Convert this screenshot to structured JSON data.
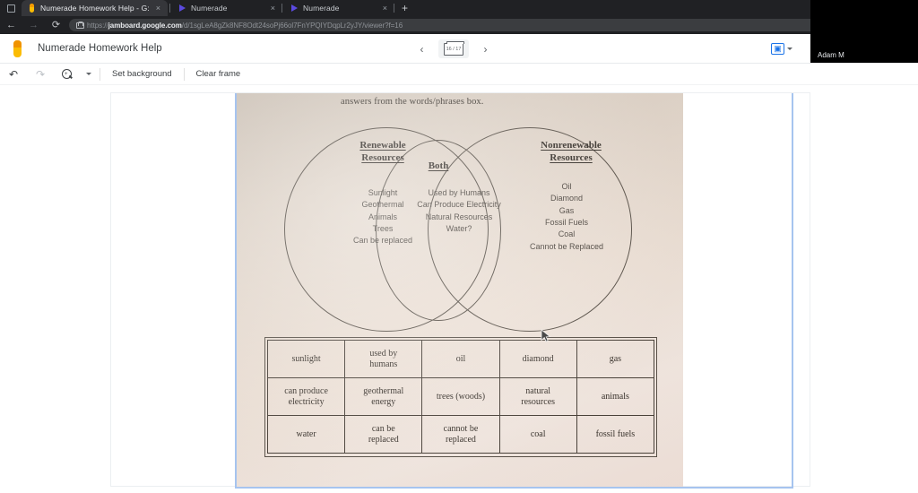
{
  "browser": {
    "window_icon": "window-restore-icon",
    "tabs": [
      {
        "title": "Numerade Homework Help - G:",
        "favicon": "jamboard-icon",
        "active": true,
        "close": "×"
      },
      {
        "title": "Numerade",
        "favicon": "numerade-icon",
        "active": false,
        "close": "×"
      },
      {
        "title": "Numerade",
        "favicon": "numerade-icon",
        "active": false,
        "close": "×"
      }
    ],
    "new_tab_label": "+",
    "back_label": "←",
    "forward_label": "→",
    "reload_label": "⟳",
    "url_scheme": "https://",
    "url_host": "jamboard.google.com",
    "url_path": "/d/1sgLeA8gZk8NF8Odt24soPj66ol7FnYPQIYDqpLr2yJY/viewer?f=16",
    "omnibox_icons": [
      "font-size-icon",
      "extensions-icon"
    ]
  },
  "jamboard": {
    "logo": "jamboard-logo-icon",
    "title": "Numerade Homework Help",
    "frame_nav": {
      "prev": "‹",
      "next": "›",
      "frame_counter": "16 / 17",
      "thumbnail_icon": "frame-thumbnail-icon"
    },
    "present_button_label": "▣",
    "present_caret": "▾",
    "toolbar": {
      "undo": "↶",
      "redo": "↷",
      "zoom_icon": "zoom-in-icon",
      "zoom_caret": "▾",
      "set_background": "Set background",
      "clear_frame": "Clear frame"
    },
    "tools": [
      {
        "name": "pen-tool",
        "glyph": "✎",
        "active": false
      },
      {
        "name": "eraser-tool",
        "glyph": "◢",
        "active": false
      },
      {
        "name": "select-tool",
        "glyph": "➤",
        "active": true
      },
      {
        "name": "sticky-note-tool",
        "glyph": "▤",
        "active": false
      },
      {
        "name": "image-tool",
        "glyph": "◰",
        "active": false
      },
      {
        "name": "shape-tool",
        "glyph": "○",
        "active": false
      },
      {
        "name": "text-box-tool",
        "glyph": "⊞",
        "active": false
      },
      {
        "name": "laser-tool",
        "glyph": "⚡",
        "active": false
      }
    ]
  },
  "video": {
    "participant_name": "Adam M"
  },
  "worksheet": {
    "instruction": "answers from the words/phrases box.",
    "venn": {
      "left_heading": "Renewable\nResources",
      "right_heading": "Nonrenewable\nResources",
      "center_heading": "Both",
      "left_items": [
        "Sunlight",
        "Geothermal",
        "Animals",
        "Trees",
        "Can be replaced"
      ],
      "center_items": [
        "Used by Humans",
        "Can Produce Electricity",
        "Natural Resources",
        "Water?"
      ],
      "right_items": [
        "Oil",
        "Diamond",
        "Gas",
        "Fossil Fuels",
        "Coal",
        "Cannot be Replaced"
      ]
    },
    "word_bank": [
      [
        "sunlight",
        "used by\nhumans",
        "oil",
        "diamond",
        "gas"
      ],
      [
        "can produce\nelectricity",
        "geothermal\nenergy",
        "trees (woods)",
        "natural\nresources",
        "animals"
      ],
      [
        "water",
        "can be\nreplaced",
        "cannot be\nreplaced",
        "coal",
        "fossil fuels"
      ]
    ]
  },
  "colors": {
    "chrome_bg": "#202124",
    "accent_blue": "#1a73e8",
    "selection_blue": "#a6c4ef",
    "jam_yellow": "#fbbc04"
  }
}
